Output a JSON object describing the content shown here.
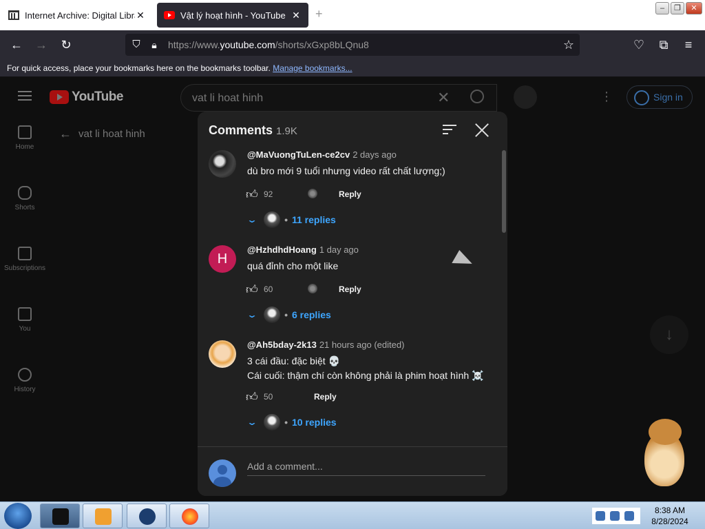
{
  "browser": {
    "tabs": [
      {
        "title": "Internet Archive: Digital Library",
        "active": false
      },
      {
        "title": "Vật lý hoạt hình - YouTube",
        "active": true
      }
    ],
    "url_prefix": "https://www.",
    "url_domain": "youtube.com",
    "url_path": "/shorts/xGxp8bLQnu8",
    "bookmarks_message": "For quick access, place your bookmarks here on the bookmarks toolbar.",
    "manage_bookmarks": "Manage bookmarks..."
  },
  "youtube": {
    "logo_text": "YouTube",
    "search_value": "vat li hoat hinh",
    "sign_in": "Sign in",
    "back_label": "vat li hoat hinh",
    "sidebar": [
      {
        "label": "Home"
      },
      {
        "label": "Shorts"
      },
      {
        "label": "Subscriptions"
      },
      {
        "label": "You"
      },
      {
        "label": "History"
      }
    ]
  },
  "comments_panel": {
    "title": "Comments",
    "count": "1.9K",
    "add_placeholder": "Add a comment...",
    "comments": [
      {
        "author": "@MaVuongTuLen-ce2cv",
        "time": "2 days ago",
        "text": "dù bro mới 9 tuổi nhưng video rất chất lượng;)",
        "likes": "92",
        "reply_label": "Reply",
        "replies": "11 replies"
      },
      {
        "author": "@HzhdhdHoang",
        "time": "1 day ago",
        "avatar_letter": "H",
        "text": "quá đỉnh cho một like",
        "likes": "60",
        "reply_label": "Reply",
        "replies": "6 replies"
      },
      {
        "author": "@Ah5bday-2k13",
        "time": "21 hours ago (edited)",
        "text_line1": "3 cái đầu: đặc biệt 💀",
        "text_line2": "Cái cuối: thậm chí còn không phải là phim hoạt hình ☠️",
        "likes": "50",
        "reply_label": "Reply",
        "replies": "10 replies"
      }
    ]
  },
  "taskbar": {
    "time": "8:38 AM",
    "date": "8/28/2024"
  },
  "colors": {
    "panel_bg": "#212121",
    "link_blue": "#3ea6ff",
    "avatar_h": "#c21c55",
    "browser_chrome": "#2b2a33"
  }
}
